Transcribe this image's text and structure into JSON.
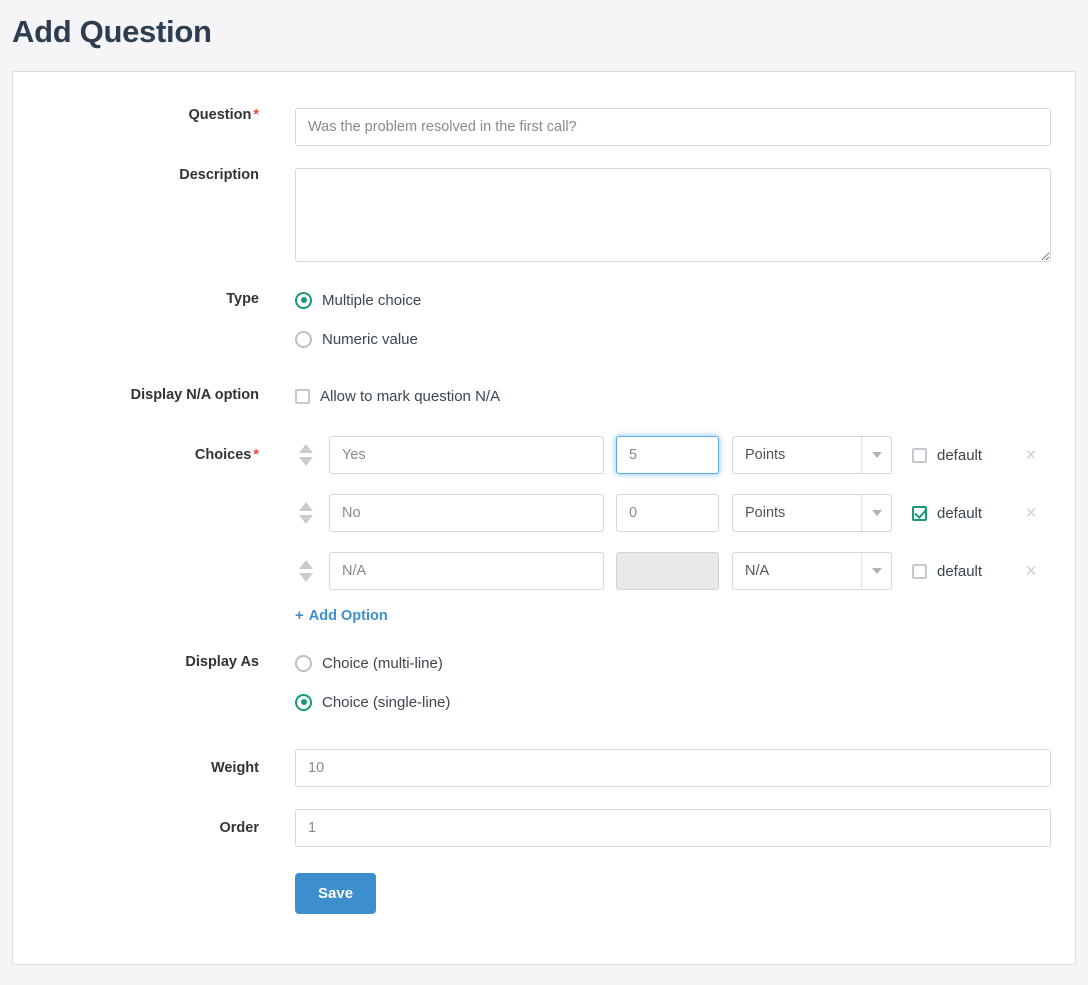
{
  "page": {
    "title": "Add Question"
  },
  "form": {
    "question": {
      "label": "Question",
      "required_mark": "*",
      "value": "",
      "placeholder": "Was the problem resolved in the first call?"
    },
    "description": {
      "label": "Description",
      "value": "",
      "placeholder": ""
    },
    "type": {
      "label": "Type",
      "options": [
        {
          "label": "Multiple choice",
          "selected": true
        },
        {
          "label": "Numeric value",
          "selected": false
        }
      ]
    },
    "display_na": {
      "label": "Display N/A option",
      "checkbox_label": "Allow to mark question N/A",
      "checked": false
    },
    "choices": {
      "label": "Choices",
      "required_mark": "*",
      "default_label": "default",
      "delete_icon": "×",
      "rows": [
        {
          "text_placeholder": "Yes",
          "text_value": "",
          "points_placeholder": "5",
          "points_value": "",
          "points_focused": true,
          "points_disabled": false,
          "scale": "Points",
          "default_checked": false
        },
        {
          "text_placeholder": "No",
          "text_value": "",
          "points_placeholder": "0",
          "points_value": "",
          "points_focused": false,
          "points_disabled": false,
          "scale": "Points",
          "default_checked": true
        },
        {
          "text_placeholder": "N/A",
          "text_value": "",
          "points_placeholder": "",
          "points_value": "",
          "points_focused": false,
          "points_disabled": true,
          "scale": "N/A",
          "default_checked": false
        }
      ],
      "add_option_label": "Add Option",
      "add_option_icon": "+"
    },
    "display_as": {
      "label": "Display As",
      "options": [
        {
          "label": "Choice (multi-line)",
          "selected": false
        },
        {
          "label": "Choice (single-line)",
          "selected": true
        }
      ]
    },
    "weight": {
      "label": "Weight",
      "value": "",
      "placeholder": "10"
    },
    "order": {
      "label": "Order",
      "value": "",
      "placeholder": "1"
    },
    "save_label": "Save"
  },
  "colors": {
    "accent_green": "#179b74",
    "primary_blue": "#3d8ecd",
    "required_red": "#e74c3c",
    "page_bg": "#f5f5f7"
  }
}
